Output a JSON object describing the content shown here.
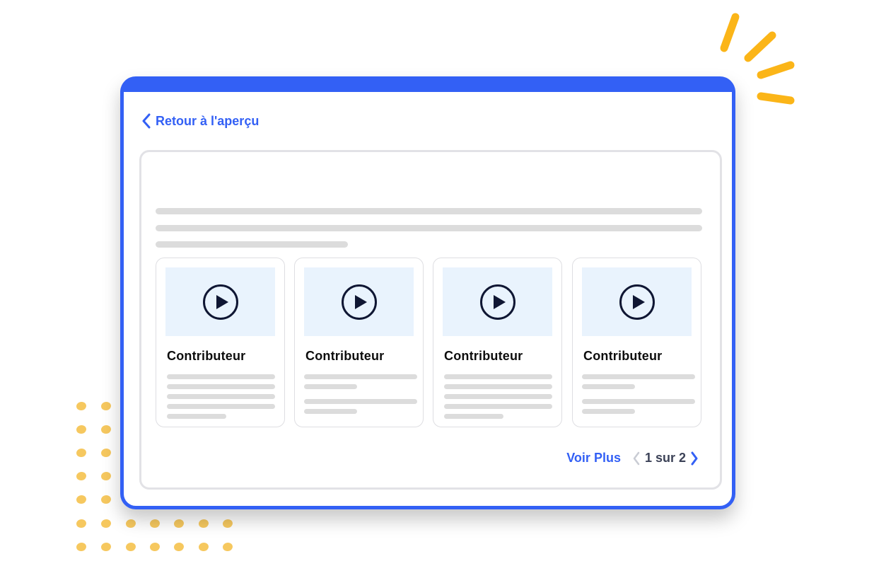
{
  "colors": {
    "accent": "#3360f5",
    "dots": "#f6c85f",
    "rays": "#fbb518",
    "thumbnail_bg": "#e9f3fd",
    "placeholder_line": "#dcdcdc",
    "play_icon": "#0f1633"
  },
  "nav": {
    "back_label": "Retour à l'aperçu",
    "back_icon": "chevron-left-icon"
  },
  "cards": [
    {
      "title": "Contributeur",
      "icon": "play-icon"
    },
    {
      "title": "Contributeur",
      "icon": "play-icon"
    },
    {
      "title": "Contributeur",
      "icon": "play-icon"
    },
    {
      "title": "Contributeur",
      "icon": "play-icon"
    }
  ],
  "footer": {
    "more_label": "Voir Plus",
    "pagination": "1 sur 2",
    "prev_icon": "chevron-left-icon",
    "next_icon": "chevron-right-icon"
  }
}
